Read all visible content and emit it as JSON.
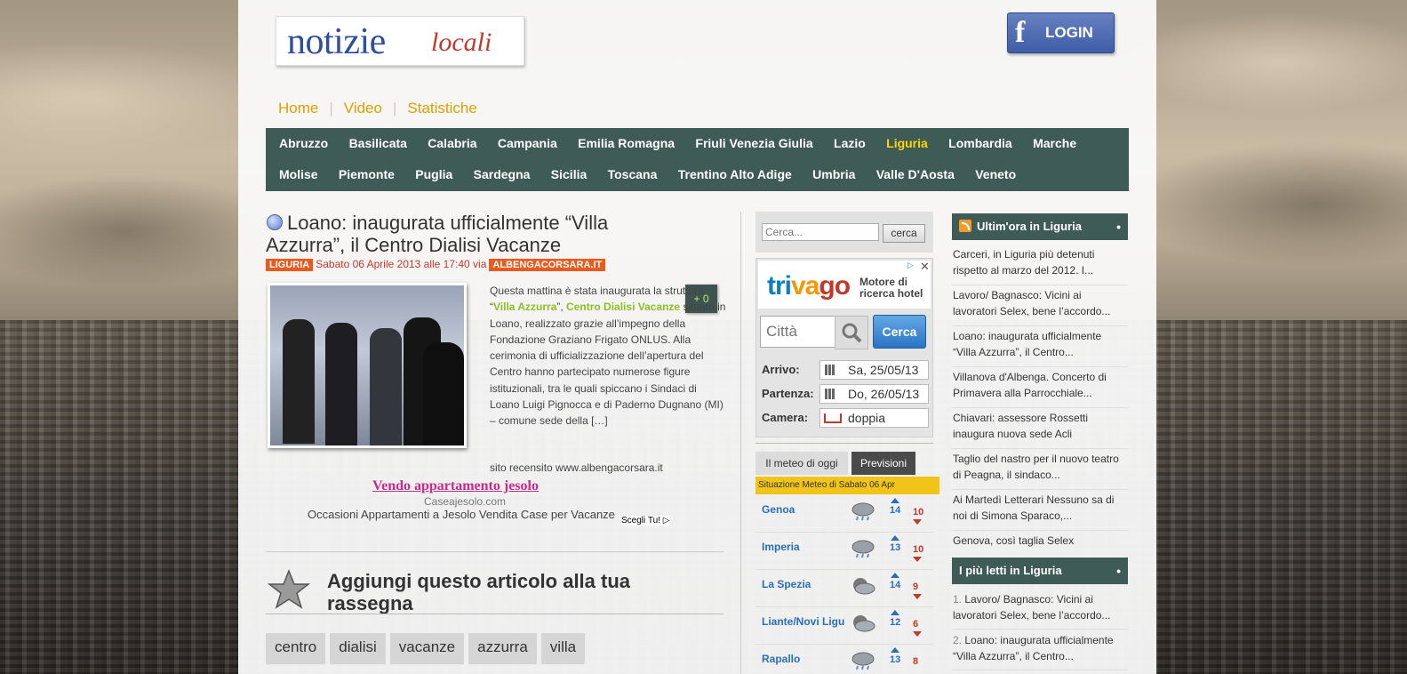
{
  "site": {
    "logo_word": "notizie",
    "logo_italic": "locali",
    "login_label": "LOGIN",
    "fb_glyph": "f"
  },
  "topnav": {
    "items": [
      "Home",
      "Video",
      "Statistiche"
    ]
  },
  "regions": {
    "row1": [
      "Abruzzo",
      "Basilicata",
      "Calabria",
      "Campania",
      "Emilia Romagna",
      "Friuli Venezia Giulia",
      "Lazio",
      "Liguria",
      "Lombardia",
      "Marche"
    ],
    "row2": [
      "Molise",
      "Piemonte",
      "Puglia",
      "Sardegna",
      "Sicilia",
      "Toscana",
      "Trentino Alto Adige",
      "Umbria",
      "Valle D'Aosta",
      "Veneto"
    ],
    "active": "Liguria"
  },
  "article": {
    "title": "Loano: inaugurata ufficialmente “Villa Azzurra”, il Centro Dialisi Vacanze",
    "region_tag": "LIGURIA",
    "date": "Sabato 06 Aprile 2013 alle 17:40 via",
    "source_tag": "ALBENGACORSARA.IT",
    "plus_label": "+ 0",
    "text_1": "Questa mattina è stata inaugurata la struttura “",
    "hl_1": "Villa Azzurra",
    "text_2": "”, ",
    "hl_2": "Centro Dialisi Vacanze",
    "text_3": " situato in Loano, realizzato grazie all’impegno della Fondazione Graziano Frigato ONLUS. Alla cerimonia di ufficializzazione dell’apertura del Centro hanno partecipato numerose figure istituzionali, tra le quali spiccano i Sindaci di Loano Luigi Pignocca e di Paderno Dugnano (MI) – comune sede della […]",
    "recensito": "sito recensito www.albengacorsara.it"
  },
  "ad": {
    "title": "Vendo appartamento jesolo",
    "domain": "Caseajesolo.com",
    "desc": "Occasioni Appartamenti a Jesolo Vendita Case per Vacanze",
    "choice": "Scegli Tu!"
  },
  "add_section": {
    "title": "Aggiungi questo articolo alla tua rassegna",
    "tags": [
      "centro",
      "dialisi",
      "vacanze",
      "azzurra",
      "villa"
    ]
  },
  "search": {
    "placeholder": "Cerca...",
    "button": "cerca"
  },
  "trivago": {
    "logo_a": "tri",
    "logo_b": "va",
    "logo_c": "go",
    "tagline": "Motore di ricerca hotel",
    "city_placeholder": "Città",
    "search_button": "Cerca",
    "arrival_label": "Arrivo:",
    "arrival_value": "Sa, 25/05/13",
    "departure_label": "Partenza:",
    "departure_value": "Do, 26/05/13",
    "room_label": "Camera:",
    "room_value": "doppia"
  },
  "meteo": {
    "tab_today": "Il meteo di oggi",
    "tab_forecast": "Previsioni",
    "date_line": "Situazione Meteo di Sabato 06 Apr",
    "cities": [
      {
        "name": "Genoa",
        "min": "14",
        "max": "10",
        "icon": "rain-cloud-icon"
      },
      {
        "name": "Imperia",
        "min": "13",
        "max": "10",
        "icon": "rain-cloud-icon"
      },
      {
        "name": "La Spezia",
        "min": "14",
        "max": "9",
        "icon": "cloud-moon-icon"
      },
      {
        "name": "Liante/Novi Ligu",
        "min": "12",
        "max": "6",
        "icon": "cloud-moon-icon"
      },
      {
        "name": "Rapallo",
        "min": "13",
        "max": "8",
        "icon": "rain-cloud-icon"
      }
    ]
  },
  "right": {
    "latest_title": "Ultim'ora in Liguria",
    "latest": [
      "Carceri, in Liguria più detenuti rispetto al marzo del 2012. I...",
      "Lavoro/ Bagnasco: Vicini ai lavoratori Selex, bene l’accordo...",
      "Loano: inaugurata ufficialmente “Villa Azzurra”, il Centro...",
      "Villanova d'Albenga. Concerto di Primavera alla Parrocchiale...",
      "Chiavari: assessore Rossetti inaugura nuova sede Acli",
      "Taglio del nastro per il nuovo teatro di Peagna, il sindaco...",
      "Ai Martedì Letterari Nessuno sa di noi di Simona Sparaco,...",
      "Genova, così taglia Selex"
    ],
    "most_title": "I più letti in Liguria",
    "most": [
      {
        "num": "1.",
        "text": "Lavoro/ Bagnasco: Vicini ai lavoratori Selex, bene l’accordo..."
      },
      {
        "num": "2.",
        "text": "Loano: inaugurata ufficialmente “Villa Azzurra”, il Centro..."
      }
    ],
    "dot": "•"
  },
  "colors": {
    "nav_bg": "#3e5b56",
    "accent_gold": "#d9a200",
    "tag_orange": "#e85a1e",
    "link_green": "#8cbf26"
  }
}
